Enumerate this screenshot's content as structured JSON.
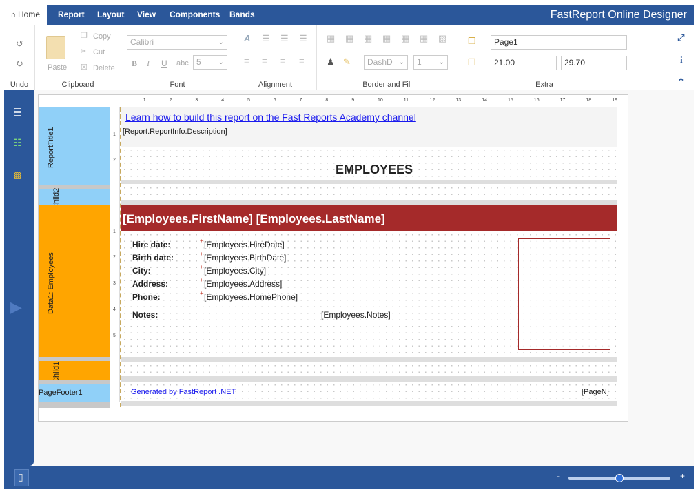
{
  "menu": {
    "tabs": [
      {
        "label": "Home",
        "icon": "home-icon"
      },
      {
        "label": "Report"
      },
      {
        "label": "Layout"
      },
      {
        "label": "View"
      },
      {
        "label": "Components"
      },
      {
        "label": "Bands"
      }
    ],
    "app_title": "FastReport Online Designer"
  },
  "ribbon": {
    "undo_group": {
      "label": "Undo"
    },
    "clipboard": {
      "label": "Clipboard",
      "paste": "Paste",
      "copy": "Copy",
      "cut": "Cut",
      "delete": "Delete"
    },
    "font": {
      "label": "Font",
      "family": "Calibri",
      "size": "5",
      "bold": "B",
      "italic": "I",
      "underline": "U",
      "strike": "abc"
    },
    "alignment": {
      "label": "Alignment"
    },
    "border": {
      "label": "Border and Fill",
      "dash": "DashD",
      "width": "1"
    },
    "extra": {
      "label": "Extra",
      "page_name": "Page1",
      "width": "21.00",
      "height": "29.70"
    }
  },
  "ruler": {
    "marks": [
      "1",
      "2",
      "3",
      "4",
      "5",
      "6",
      "7",
      "8",
      "9",
      "10",
      "11",
      "12",
      "13",
      "14",
      "15",
      "16",
      "17",
      "18",
      "19"
    ]
  },
  "bands": {
    "report_title": "ReportTitle1",
    "child2": "Child2",
    "data1": "Data1: Employees",
    "child1": "Child1",
    "page_footer": "PageFooter1"
  },
  "report": {
    "academy_link": "Learn how to build this report on the Fast Reports Academy channel",
    "description": "[Report.ReportInfo.Description]",
    "title": "EMPLOYEES",
    "name_header": "[Employees.FirstName] [Employees.LastName]",
    "fields": [
      {
        "label": "Hire date:",
        "value": "[Employees.HireDate]"
      },
      {
        "label": "Birth date:",
        "value": "[Employees.BirthDate]"
      },
      {
        "label": "City:",
        "value": "[Employees.City]"
      },
      {
        "label": "Address:",
        "value": "[Employees.Address]"
      },
      {
        "label": "Phone:",
        "value": "[Employees.HomePhone]"
      }
    ],
    "notes_label": "Notes:",
    "notes_value": "[Employees.Notes]",
    "footer_link": "Generated by FastReport .NET",
    "page_number": "[PageN]"
  },
  "zoom": {
    "minus": "-",
    "plus": "+",
    "level": 0.5
  },
  "colors": {
    "accent": "#2b579a",
    "title_band": "#90d0f8",
    "data_band": "#ffa500",
    "header_fill": "#a52a2a"
  }
}
